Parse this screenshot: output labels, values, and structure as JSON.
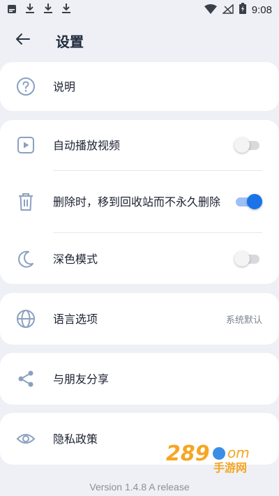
{
  "status_bar": {
    "time": "9:08",
    "icons": [
      "app-notification-icon",
      "download-icon",
      "download-icon",
      "download-icon",
      "wifi-icon",
      "no-signal-icon",
      "battery-charging-icon"
    ]
  },
  "header": {
    "title": "设置",
    "back_icon": "arrow-left-icon"
  },
  "sections": {
    "help": {
      "label": "说明",
      "icon": "question-circle-icon"
    },
    "autoplay": {
      "label": "自动播放视频",
      "icon": "play-square-icon",
      "enabled": false
    },
    "trash": {
      "label": "删除时，移到回收站而不永久删除",
      "icon": "trash-icon",
      "enabled": true
    },
    "dark_mode": {
      "label": "深色模式",
      "icon": "moon-icon",
      "enabled": false
    },
    "language": {
      "label": "语言选项",
      "value": "系统默认",
      "icon": "globe-icon"
    },
    "share": {
      "label": "与朋友分享",
      "icon": "share-icon"
    },
    "privacy": {
      "label": "隐私政策",
      "icon": "eye-icon"
    }
  },
  "footer": {
    "version": "Version 1.4.8 A release"
  },
  "watermark": {
    "text": "289.com 手游网"
  },
  "colors": {
    "background": "#eef0f5",
    "card": "#ffffff",
    "accent": "#1a73e8",
    "icon": "#8ba0c0"
  }
}
